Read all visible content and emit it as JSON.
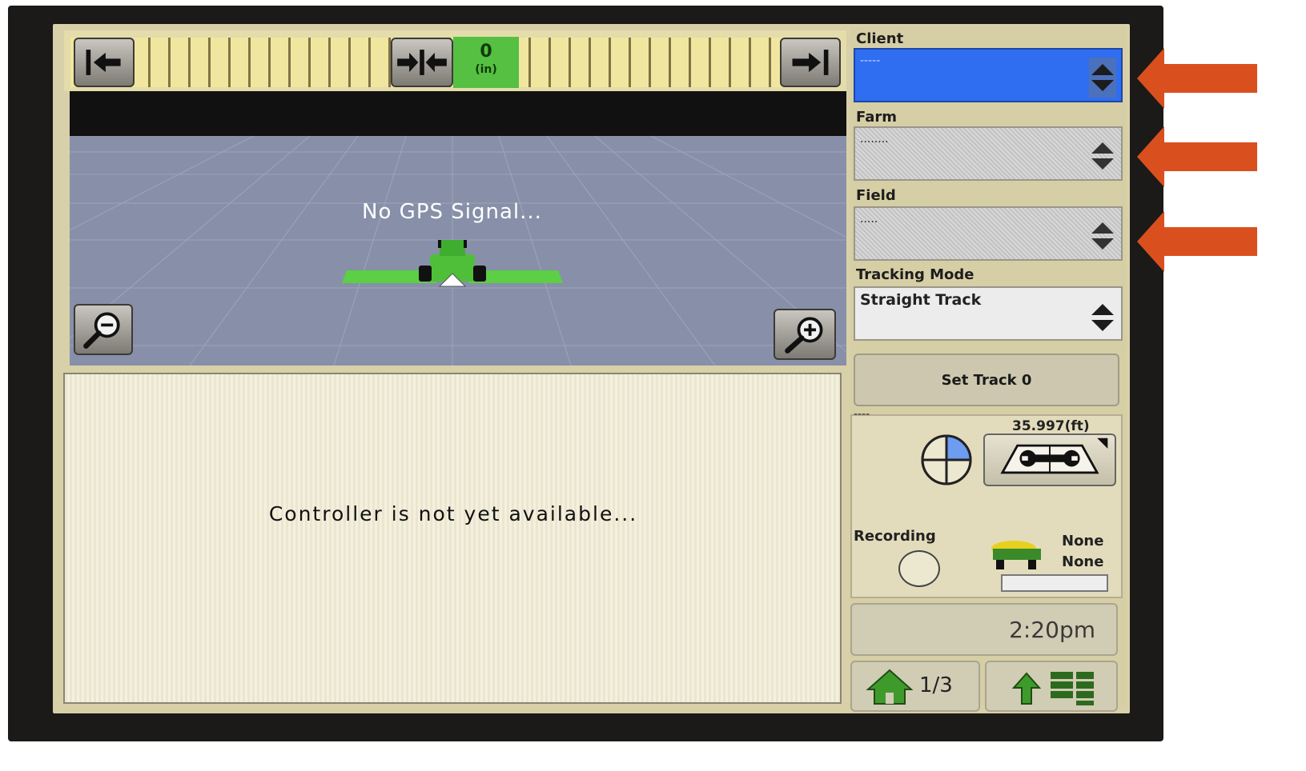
{
  "lightbar": {
    "offset_value": "0",
    "offset_unit": "(in)"
  },
  "map": {
    "message": "No GPS Signal..."
  },
  "controller": {
    "message": "Controller is not yet available..."
  },
  "fields": {
    "client": {
      "label": "Client",
      "value": "-----"
    },
    "farm": {
      "label": "Farm",
      "value": "........"
    },
    "field": {
      "label": "Field",
      "value": "....."
    },
    "tracking_mode": {
      "label": "Tracking Mode",
      "value": "Straight Track"
    }
  },
  "set_track": {
    "label": "Set Track 0"
  },
  "status": {
    "dashes": "----",
    "width": "35.997(ft)",
    "recording_label": "Recording",
    "implement_line1": "None",
    "implement_line2": "None"
  },
  "clock": {
    "time": "2:20pm"
  },
  "nav": {
    "page": "1/3"
  },
  "colors": {
    "accent_blue": "#2f6ef0",
    "arrow_orange": "#d9501e",
    "guidance_green": "#55c042"
  }
}
